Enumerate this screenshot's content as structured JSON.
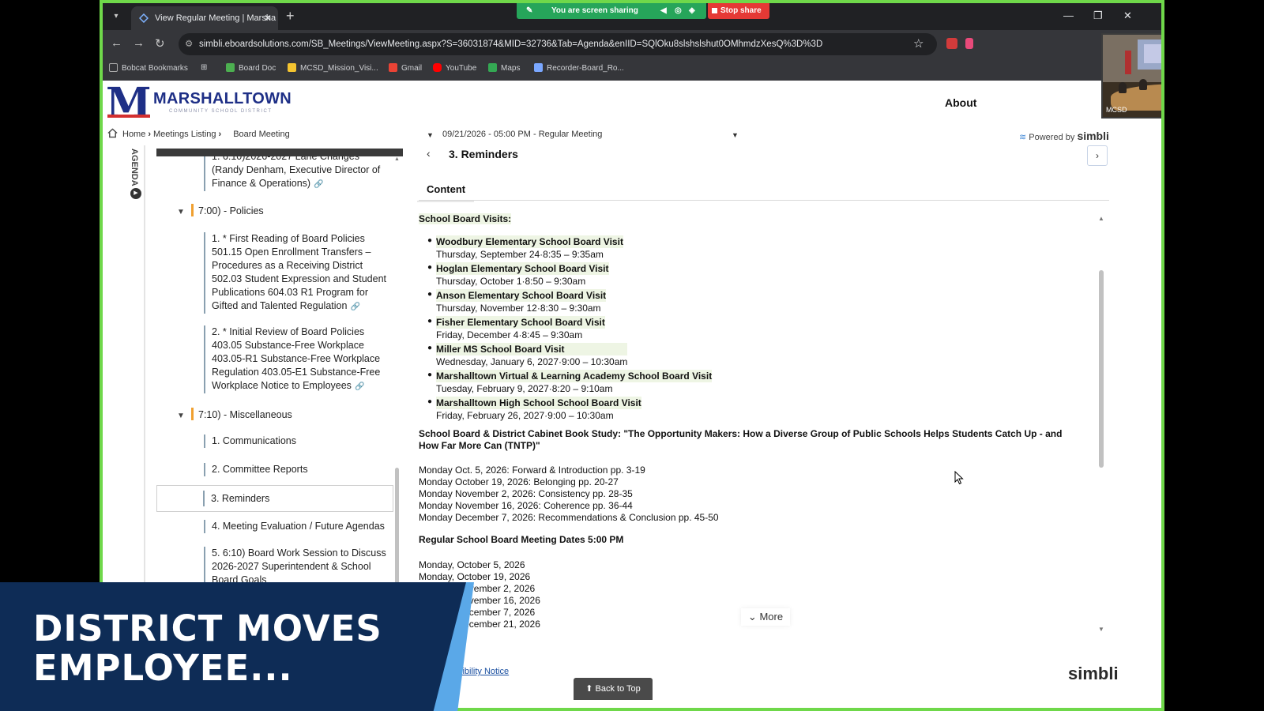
{
  "browser": {
    "tab_title": "View Regular Meeting | Marsha",
    "url": "simbli.eboardsolutions.com/SB_Meetings/ViewMeeting.aspx?S=36031874&MID=32736&Tab=Agenda&enIID=SQlOku8slshslshut0OMhmdzXesQ%3D%3D",
    "share_status": "You are screen sharing",
    "stop_share_label": "Stop share",
    "bookmarks": [
      "Bobcat Bookmarks",
      "Board Doc",
      "MCSD_Mission_Visi...",
      "Gmail",
      "YouTube",
      "Maps",
      "Recorder-Board_Ro..."
    ]
  },
  "site": {
    "logo_letter": "M",
    "logo_name": "MARSHALLTOWN",
    "logo_sub": "COMMUNITY SCHOOL DISTRICT",
    "about_label": "About",
    "powered_by": "Powered by",
    "powered_brand": "simbli"
  },
  "breadcrumb": {
    "home": "Home",
    "meetings": "Meetings Listing",
    "board": "Board Meeting",
    "meeting": "09/21/2026 - 05:00 PM - Regular Meeting"
  },
  "agenda": {
    "rail_label": "AGENDA",
    "header_label": "AGENDA",
    "items": [
      {
        "text": "1. 6:10)2026-2027 Lane Changes (Randy Denham, Executive Director of Finance & Operations)"
      },
      {
        "text": "7:00) - Policies"
      },
      {
        "text": "1. * First Reading of Board Policies 501.15 Open Enrollment Transfers – Procedures as a Receiving District 502.03 Student Expression and Student Publications 604.03 R1 Program for Gifted and Talented Regulation"
      },
      {
        "text": "2. * Initial Review of Board Policies 403.05 Substance-Free Workplace 403.05-R1 Substance-Free Workplace Regulation 403.05-E1 Substance-Free Workplace Notice to Employees"
      },
      {
        "text": "7:10) - Miscellaneous"
      },
      {
        "text": "1. Communications"
      },
      {
        "text": "2. Committee Reports"
      },
      {
        "text": "3. Reminders"
      },
      {
        "text": "4. Meeting Evaluation / Future Agendas"
      },
      {
        "text": "5. 6:10) Board Work Session to Discuss 2026-2027 Superintendent & School Board Goals"
      }
    ]
  },
  "content": {
    "item_title": "3. Reminders",
    "tab_label": "Content",
    "visits_title": "School Board Visits:",
    "visits": [
      {
        "name": "Woodbury Elementary School Board Visit",
        "when": "Thursday, September 24·8:35 – 9:35am"
      },
      {
        "name": "Hoglan Elementary School Board Visit",
        "when": "Thursday, October 1·8:50 – 9:30am"
      },
      {
        "name": "Anson Elementary School Board Visit",
        "when": "Thursday, November 12·8:30 – 9:30am"
      },
      {
        "name": "Fisher Elementary School Board Visit",
        "when": "Friday, December 4·8:45 – 9:30am"
      },
      {
        "name": "Miller MS School Board Visit",
        "when": "Wednesday, January 6, 2027·9:00 – 10:30am"
      },
      {
        "name": "Marshalltown Virtual & Learning Academy School Board Visit",
        "when": "Tuesday, February 9, 2027·8:20 – 9:10am"
      },
      {
        "name": "Marshalltown High School School Board Visit",
        "when": "Friday, February 26, 2027·9:00 – 10:30am"
      }
    ],
    "book_title": "School Board & District Cabinet Book Study: \"The Opportunity Makers: How a Diverse Group of Public Schools Helps Students Catch Up - and How Far More Can (TNTP)\"",
    "book_schedule": [
      "Monday Oct. 5, 2026: Forward & Introduction pp. 3-19",
      "Monday October 19, 2026:  Belonging pp. 20-27",
      "Monday November 2, 2026: Consistency pp. 28-35",
      "Monday November 16, 2026: Coherence pp. 36-44",
      "Monday December 7, 2026: Recommendations & Conclusion pp. 45-50"
    ],
    "dates_title": "Regular School Board Meeting Dates 5:00 PM",
    "dates": [
      "Monday, October 5, 2026",
      "Monday, October 19, 2026",
      "Monday, November 2, 2026",
      "Monday, November 16, 2026",
      "Monday, December 7, 2026",
      "Monday, December 21, 2026"
    ],
    "more_label": "More"
  },
  "footer": {
    "notice_link": "Accessibility Notice",
    "back_to_top": "Back to Top",
    "brand": "simbli"
  },
  "webcam": {
    "label": "MCSD"
  },
  "lower_third": {
    "headline": "DISTRICT MOVES EMPLOYEE..."
  },
  "colors": {
    "frame": "#6fd84a",
    "brand_blue": "#1e2f86",
    "lower_third_bg": "#0e2c56",
    "lower_third_accent": "#5aa8e8",
    "share_green": "#26a55a",
    "stop_red": "#e53935"
  }
}
